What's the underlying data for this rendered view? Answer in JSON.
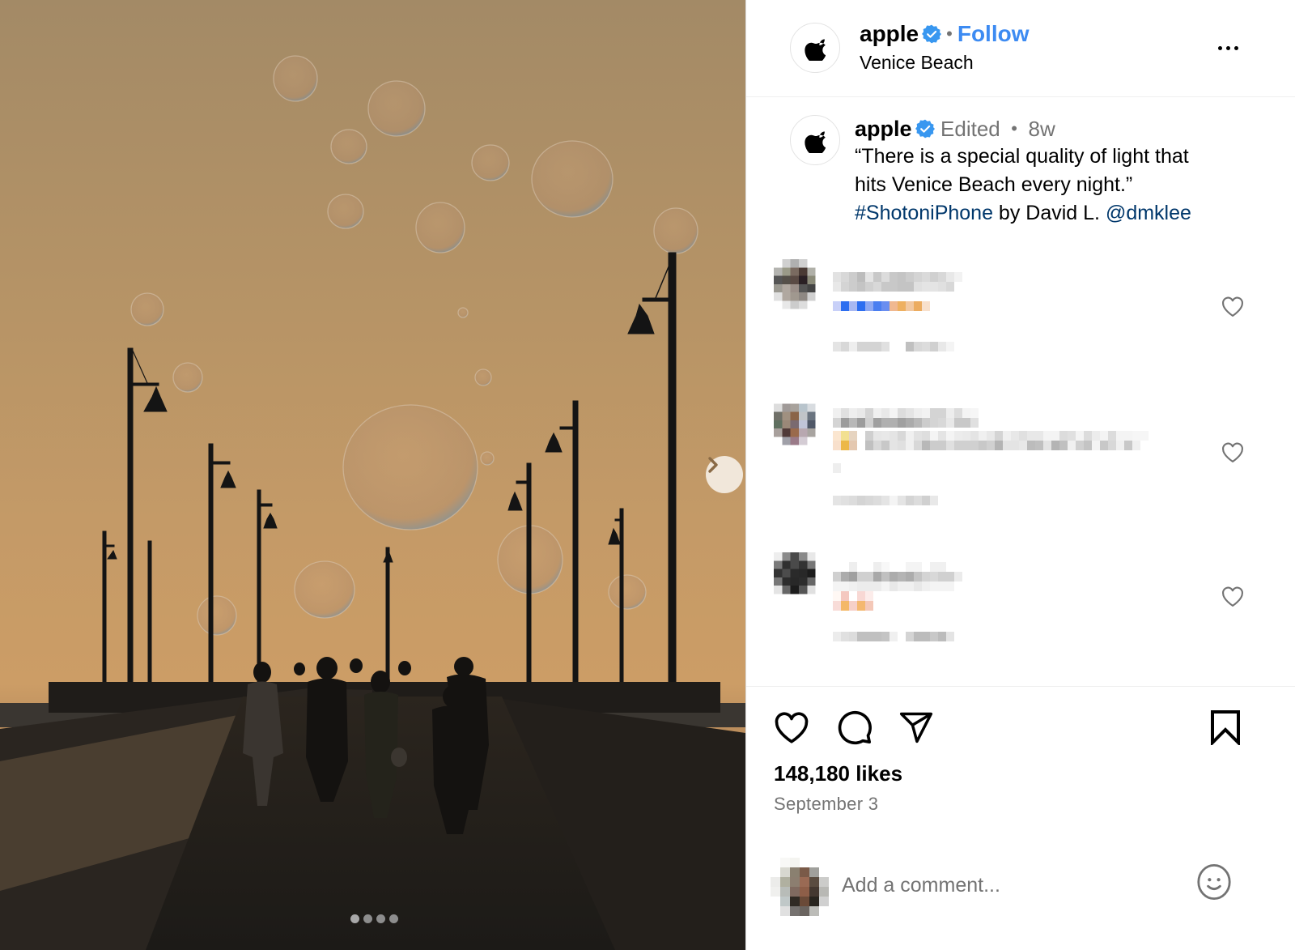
{
  "post": {
    "author": "apple",
    "verified": true,
    "follow_label": "Follow",
    "separator": "•",
    "location": "Venice Beach",
    "more_icon": "more-horizontal-icon"
  },
  "media": {
    "description": "Photo of soap bubbles floating over Venice Beach pier at sunset with lamp posts and silhouetted people",
    "carousel": {
      "total": 4,
      "current": 1
    },
    "next_icon": "chevron-right-icon"
  },
  "caption": {
    "author": "apple",
    "edited_label": "Edited",
    "separator": "•",
    "time_ago": "8w",
    "text_line1": "“There is a special quality of light that",
    "text_line2": "hits Venice Beach every night.”",
    "hashtag": "#ShotoniPhone",
    "by_text": " by David L. ",
    "mention": "@dmklee"
  },
  "comments": [
    {
      "username": "[redacted]",
      "text": "[redacted]",
      "meta": "[redacted]",
      "like_icon": "heart-outline-icon"
    },
    {
      "username": "[redacted]",
      "text": "[redacted]",
      "meta": "[redacted]",
      "like_icon": "heart-outline-icon"
    },
    {
      "username": "[redacted]",
      "text": "[redacted]",
      "meta": "[redacted]",
      "like_icon": "heart-outline-icon"
    }
  ],
  "actions": {
    "like_icon": "heart-outline-icon",
    "comment_icon": "comment-bubble-icon",
    "share_icon": "paper-plane-icon",
    "save_icon": "bookmark-outline-icon"
  },
  "likes_text": "148,180 likes",
  "likes_count": 148180,
  "date": "September 3",
  "add_comment": {
    "placeholder": "Add a comment...",
    "emoji_icon": "smiley-face-icon"
  },
  "colors": {
    "link_blue": "#3d8bf2",
    "hashtag_blue": "#00376b",
    "secondary_text": "#737373",
    "verified_blue": "#3897f0"
  }
}
